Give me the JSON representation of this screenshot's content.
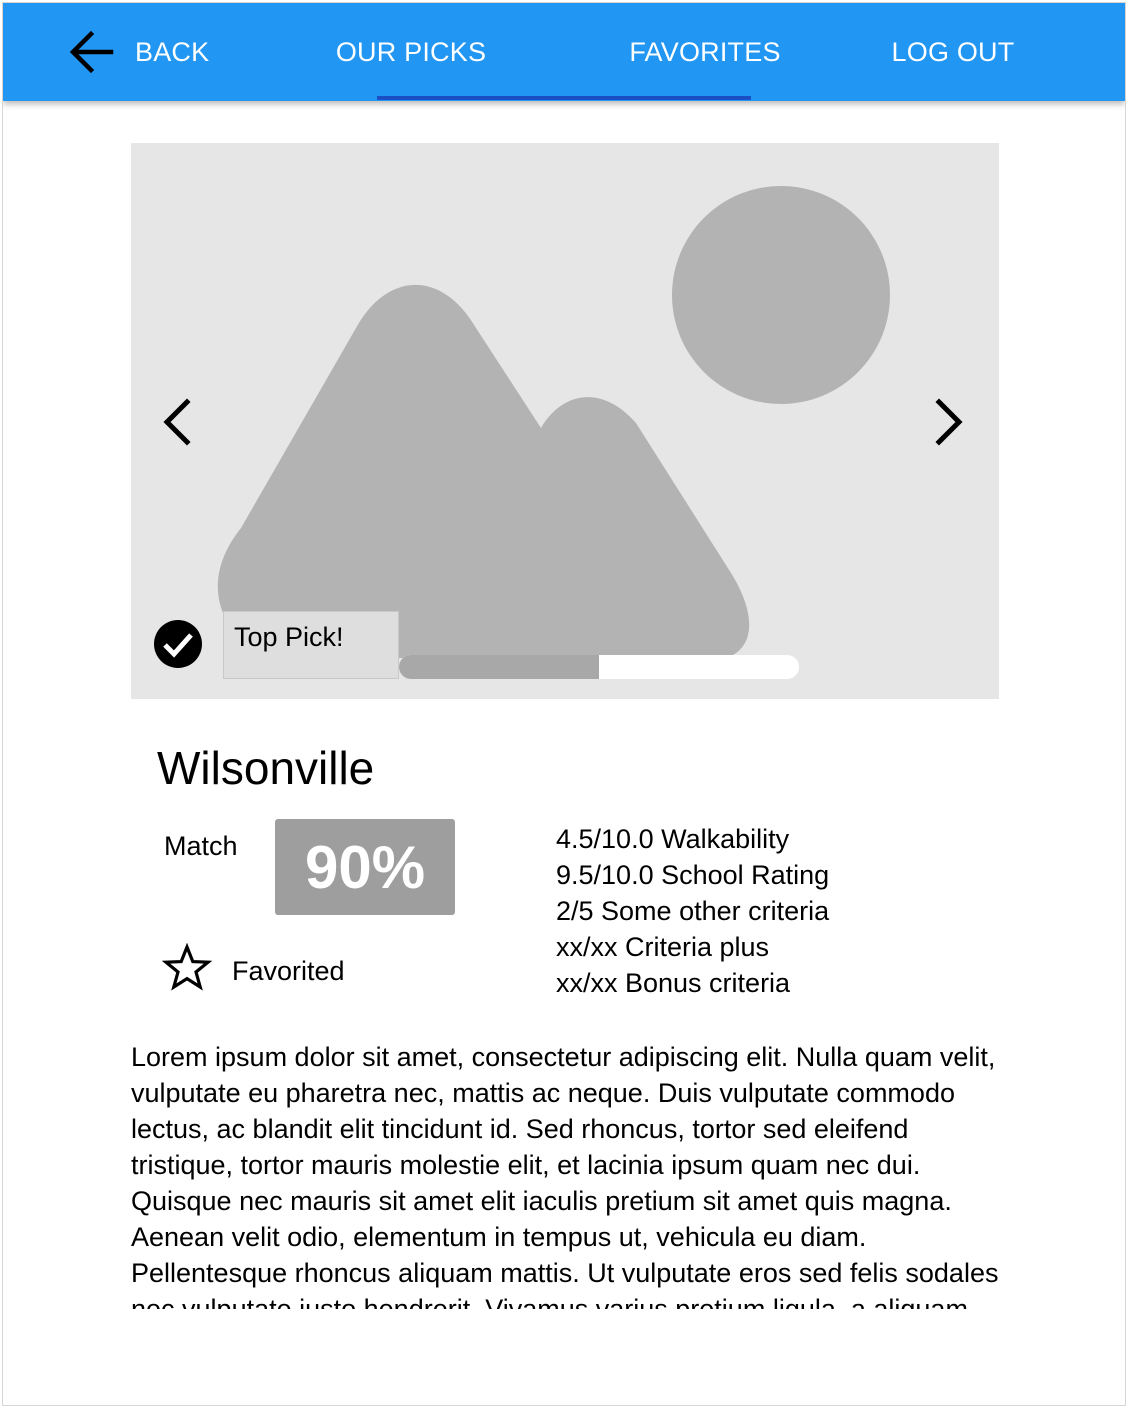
{
  "header": {
    "back_label": "BACK",
    "tabs": [
      {
        "label": "OUR PICKS"
      },
      {
        "label": "FAVORITES"
      },
      {
        "label": "LOG OUT"
      }
    ],
    "active_tab": "OUR PICKS"
  },
  "carousel": {
    "image_icon": "image-placeholder-icon",
    "prev_icon": "chevron-left-icon",
    "next_icon": "chevron-right-icon",
    "badge_icon": "check-circle-icon",
    "badge_label": "Top Pick!",
    "progress_fraction": 0.5
  },
  "listing": {
    "city": "Wilsonville",
    "match_label": "Match",
    "match_value": "90%",
    "favorite_icon": "star-outline-icon",
    "favorite_label": "Favorited",
    "criteria": [
      "4.5/10.0 Walkability",
      "9.5/10.0 School Rating",
      "2/5 Some other criteria",
      "xx/xx Criteria plus",
      "xx/xx Bonus criteria"
    ],
    "description": "Lorem ipsum dolor sit amet, consectetur adipiscing elit. Nulla quam velit, vulputate eu pharetra nec, mattis ac neque. Duis vulputate commodo lectus, ac blandit elit tincidunt id. Sed rhoncus, tortor sed eleifend tristique, tortor mauris molestie elit, et lacinia ipsum quam nec dui. Quisque nec mauris sit amet elit iaculis pretium sit amet quis magna. Aenean velit odio, elementum in tempus ut, vehicula eu diam. Pellentesque rhoncus aliquam mattis. Ut vulputate eros sed felis sodales nec vulputate justo hendrerit. Vivamus varius pretium ligula, a aliquam odio euismod sit amet."
  },
  "colors": {
    "appbar": "#2196f3",
    "tab_indicator": "#1a4fc4",
    "match_badge": "#9e9e9e",
    "image_bg": "#e6e6e6",
    "image_shapes": "#b3b3b3"
  }
}
